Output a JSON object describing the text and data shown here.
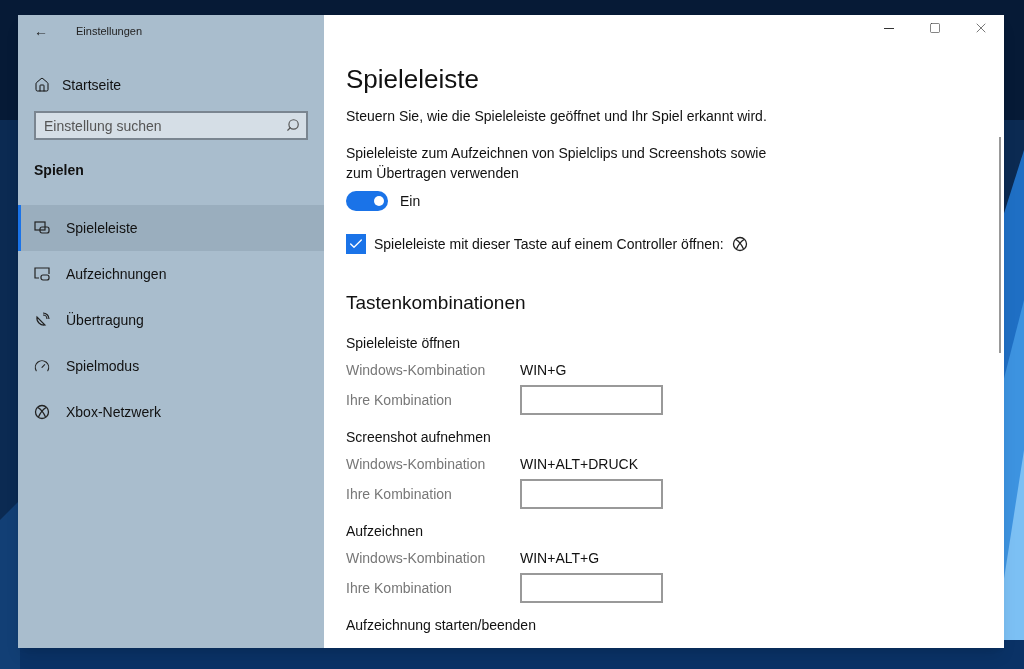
{
  "window": {
    "title": "Einstellungen",
    "back": "←"
  },
  "sidebar": {
    "home": "Startseite",
    "search": {
      "placeholder": "Einstellung suchen"
    },
    "section": "Spielen",
    "items": [
      {
        "label": "Spieleleiste",
        "selected": true
      },
      {
        "label": "Aufzeichnungen",
        "selected": false
      },
      {
        "label": "Übertragung",
        "selected": false
      },
      {
        "label": "Spielmodus",
        "selected": false
      },
      {
        "label": "Xbox-Netzwerk",
        "selected": false
      }
    ]
  },
  "page": {
    "title": "Spieleleiste",
    "description": "Steuern Sie, wie die Spieleleiste geöffnet und Ihr Spiel erkannt wird.",
    "toggle": {
      "label": "Spieleleiste zum Aufzeichnen von Spielclips und Screenshots sowie zum Übertragen verwenden",
      "on": true,
      "state": "Ein"
    },
    "checkbox": {
      "label": "Spieleleiste mit dieser Taste auf einem Controller öffnen:",
      "checked": true
    },
    "shortcuts_title": "Tastenkombinationen",
    "shortcuts": [
      {
        "title": "Spieleleiste öffnen",
        "windows_label": "Windows-Kombination",
        "windows_value": "WIN+G",
        "custom_label": "Ihre Kombination"
      },
      {
        "title": "Screenshot aufnehmen",
        "windows_label": "Windows-Kombination",
        "windows_value": "WIN+ALT+DRUCK",
        "custom_label": "Ihre Kombination"
      },
      {
        "title": "Aufzeichnen",
        "windows_label": "Windows-Kombination",
        "windows_value": "WIN+ALT+G",
        "custom_label": "Ihre Kombination"
      },
      {
        "title": "Aufzeichnung starten/beenden"
      }
    ]
  }
}
